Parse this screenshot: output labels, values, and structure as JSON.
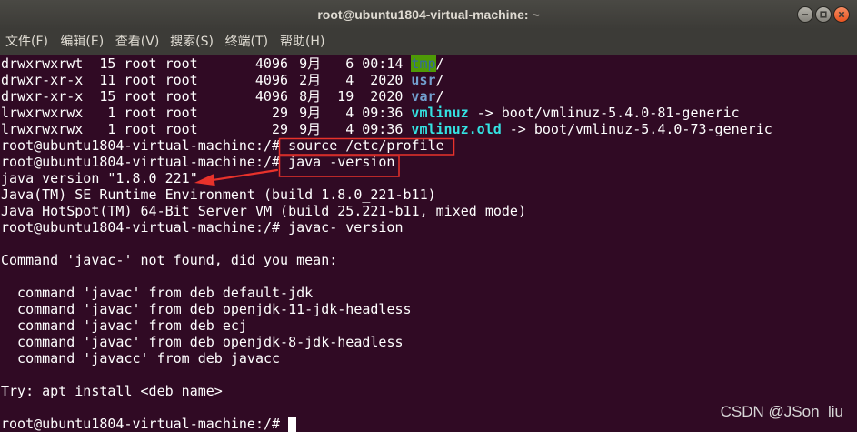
{
  "window": {
    "title": "root@ubuntu1804-virtual-machine: ~",
    "controls": {
      "minimize": "minimize-icon",
      "maximize": "maximize-icon",
      "close": "close-icon"
    }
  },
  "menu": [
    {
      "label": "文件(F)"
    },
    {
      "label": "编辑(E)"
    },
    {
      "label": "查看(V)"
    },
    {
      "label": "搜索(S)"
    },
    {
      "label": "终端(T)"
    },
    {
      "label": "帮助(H)"
    }
  ],
  "colors": {
    "titlebar": "#3c3b37",
    "menubar": "#3c3b37",
    "chrome_text": "#dfdbd2",
    "terminal_bg": "#300a24",
    "terminal_fg": "#ffffff",
    "dir": "#729fcf",
    "symlink": "#34e2e2",
    "sticky_dir_fg": "#3465a4",
    "sticky_dir_bg": "#4e9a06",
    "close_button": "#e95420",
    "annotation": "#e8322b",
    "watermark": "#d8d8d8"
  },
  "terminal": {
    "listing": [
      {
        "perms": "drwxrwxrwt",
        "links": "15",
        "owner": "root",
        "group": "root",
        "size": "4096",
        "month": "9月",
        "day": "6",
        "time": "00:14",
        "name": "tmp",
        "suffix": "/"
      },
      {
        "perms": "drwxr-xr-x",
        "links": "11",
        "owner": "root",
        "group": "root",
        "size": "4096",
        "month": "2月",
        "day": "4",
        "time": "2020",
        "name": "usr",
        "suffix": "/"
      },
      {
        "perms": "drwxr-xr-x",
        "links": "15",
        "owner": "root",
        "group": "root",
        "size": "4096",
        "month": "8月",
        "day": "19",
        "time": "2020",
        "name": "var",
        "suffix": "/"
      },
      {
        "perms": "lrwxrwxrwx",
        "links": "1",
        "owner": "root",
        "group": "root",
        "size": "29",
        "month": "9月",
        "day": "4",
        "time": "09:36",
        "name": "vmlinuz",
        "arrow": "->",
        "target": "boot/vmlinuz-5.4.0-81-generic"
      },
      {
        "perms": "lrwxrwxrwx",
        "links": "1",
        "owner": "root",
        "group": "root",
        "size": "29",
        "month": "9月",
        "day": "4",
        "time": "09:36",
        "name": "vmlinuz.old",
        "arrow": "->",
        "target": "boot/vmlinuz-5.4.0-73-generic"
      }
    ],
    "session": [
      {
        "prompt": "root@ubuntu1804-virtual-machine:/#",
        "command": "source /etc/profile"
      },
      {
        "prompt": "root@ubuntu1804-virtual-machine:/#",
        "command": "java -version",
        "output": [
          "java version \"1.8.0_221\"",
          "Java(TM) SE Runtime Environment (build 1.8.0_221-b11)",
          "Java HotSpot(TM) 64-Bit Server VM (build 25.221-b11, mixed mode)"
        ]
      },
      {
        "prompt": "root@ubuntu1804-virtual-machine:/#",
        "command": "javac- version",
        "output": [
          "Command 'javac-' not found, did you mean:",
          "  command 'javac' from deb default-jdk",
          "  command 'javac' from deb openjdk-11-jdk-headless",
          "  command 'javac' from deb ecj",
          "  command 'javac' from deb openjdk-8-jdk-headless",
          "  command 'javacc' from deb javacc",
          "Try: apt install <deb name>"
        ]
      },
      {
        "prompt": "root@ubuntu1804-virtual-machine:/#"
      }
    ]
  },
  "watermark": "CSDN @JSon  liu"
}
